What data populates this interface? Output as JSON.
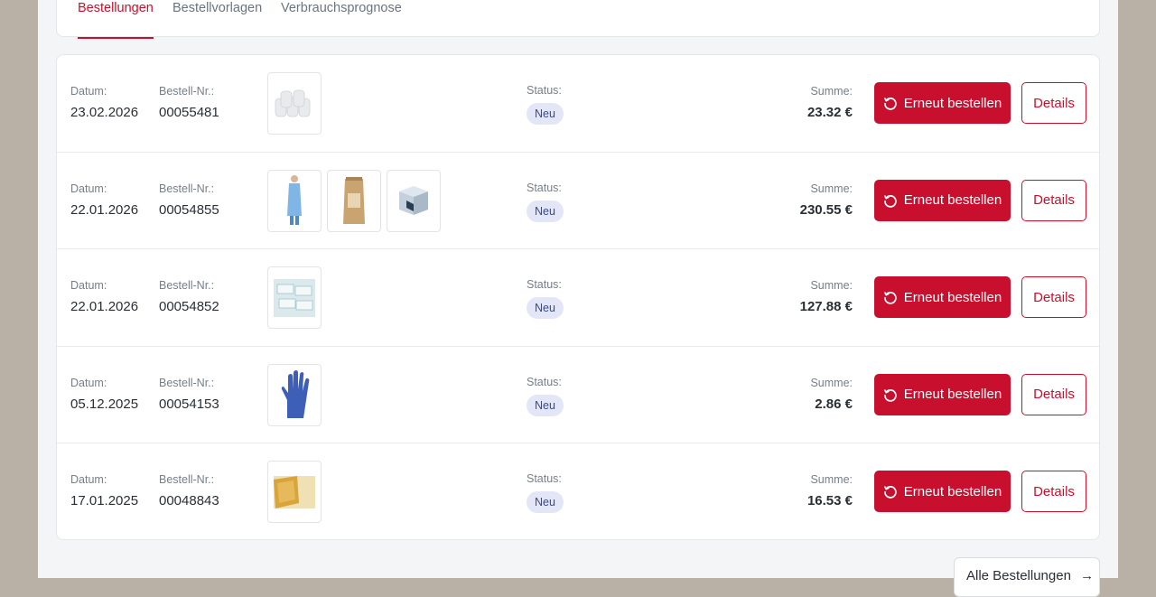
{
  "tabs": [
    {
      "label": "Bestellungen",
      "active": true
    },
    {
      "label": "Bestellvorlagen",
      "active": false
    },
    {
      "label": "Verbrauchsprognose",
      "active": false
    }
  ],
  "labels": {
    "date": "Datum:",
    "order_no": "Bestell-Nr.:",
    "status": "Status:",
    "sum": "Summe:",
    "reorder": "Erneut bestellen",
    "details": "Details"
  },
  "orders": [
    {
      "date": "23.02.2026",
      "number": "00055481",
      "status": "Neu",
      "sum": "23.32 €",
      "products": [
        "paper-towel-rolls"
      ]
    },
    {
      "date": "22.01.2026",
      "number": "00054855",
      "status": "Neu",
      "sum": "230.55 €",
      "products": [
        "blue-apron",
        "brown-bag",
        "dispenser-box"
      ]
    },
    {
      "date": "22.01.2026",
      "number": "00054852",
      "status": "Neu",
      "sum": "127.88 €",
      "products": [
        "wipes-packs"
      ]
    },
    {
      "date": "05.12.2025",
      "number": "00054153",
      "status": "Neu",
      "sum": "2.86 €",
      "products": [
        "blue-glove"
      ]
    },
    {
      "date": "17.01.2025",
      "number": "00048843",
      "status": "Neu",
      "sum": "16.53 €",
      "products": [
        "yellow-sponge-cloth"
      ]
    }
  ],
  "footer": {
    "all_orders": "Alle Bestellungen"
  },
  "colors": {
    "accent": "#c8102e",
    "badge_bg": "#e3e6f7",
    "page_bg": "#b9b0a6"
  }
}
